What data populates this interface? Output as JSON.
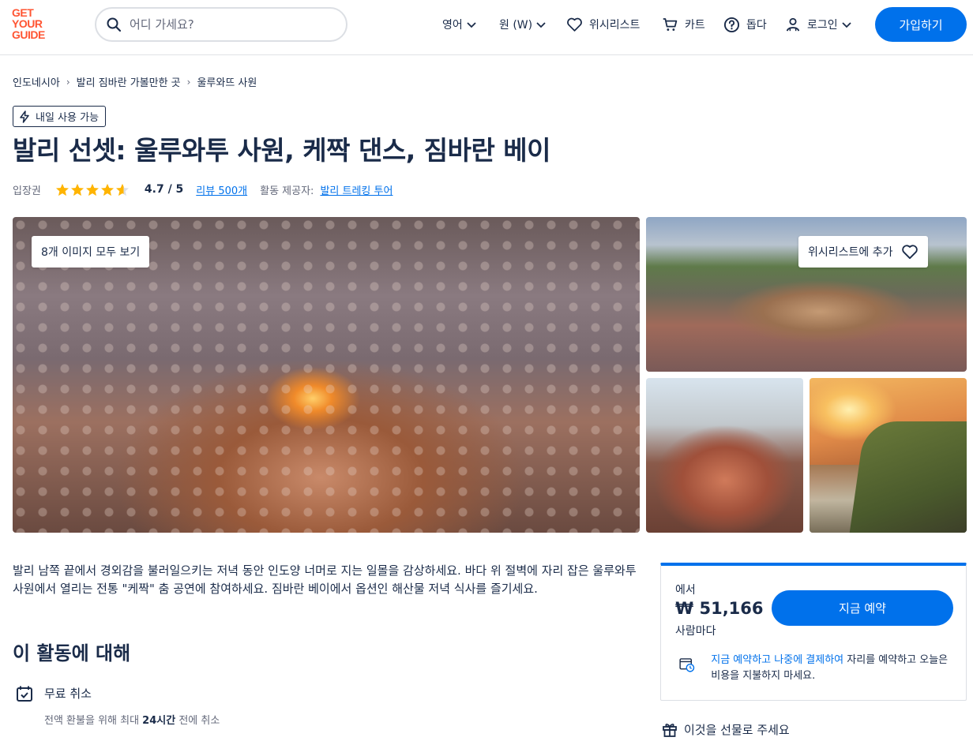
{
  "header": {
    "logo_lines": [
      "GET",
      "YOUR",
      "GUIDE"
    ],
    "search_placeholder": "어디 가세요?",
    "language": "영어",
    "currency": "원 (W)",
    "wishlist": "위시리스트",
    "cart": "카트",
    "help": "돕다",
    "login": "로그인",
    "signup": "가입하기"
  },
  "breadcrumb": [
    "인도네시아",
    "발리 짐바란 가볼만한 곳",
    "울루와뜨 사원"
  ],
  "badge": "내일 사용 가능",
  "title": "발리 선셋: 울루와투 사원, 케짝 댄스, 짐바란 베이",
  "meta": {
    "category": "입장권",
    "rating": "4.7 / 5",
    "rating_value": 4.7,
    "reviews": "리뷰 500개",
    "provider_label": "활동 제공자:",
    "provider": "발리 트레킹 투어"
  },
  "gallery": {
    "view_all": "8개 이미지 모두 보기",
    "add_wishlist": "위시리스트에 추가"
  },
  "description": "발리 남쪽 끝에서 경외감을 불러일으키는 저녁 동안 인도양 너머로 지는 일몰을 감상하세요. 바다 위 절벽에 자리 잡은 울루와투 사원에서 열리는 전통 \"케짝\" 춤 공연에 참여하세요. 짐바란 베이에서 옵션인 해산물 저녁 식사를 즐기세요.",
  "about": {
    "title": "이 활동에 대해",
    "feature_title": "무료 취소",
    "feature_sub_pre": "전액 환불을 위해 최대 ",
    "feature_sub_bold": "24시간",
    "feature_sub_post": " 전에 취소"
  },
  "booking": {
    "from": "에서",
    "price": "₩ 51,166",
    "per": "사람마다",
    "button": "지금 예약",
    "rnpl_link": "지금 예약하고 나중에 결제하여",
    "rnpl_text": " 자리를 예약하고 오늘은 비용을 지불하지 마세요.",
    "gift": "이것을 선물로 주세요"
  },
  "colors": {
    "brand": "#ff5533",
    "accent": "#0071eb",
    "text": "#1a2b49",
    "star": "#ffb400"
  }
}
